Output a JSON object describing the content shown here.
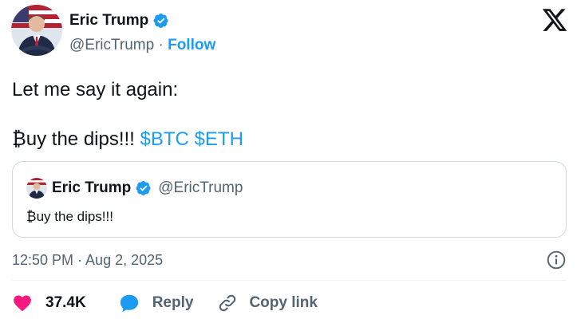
{
  "author": {
    "name": "Eric Trump",
    "handle": "@EricTrump",
    "separator": "·",
    "follow_label": "Follow",
    "verified": true
  },
  "tweet": {
    "lines": [
      "Let me say it again:",
      "₿uy the dips!!!"
    ],
    "cashtags": [
      "$BTC",
      "$ETH"
    ]
  },
  "quoted": {
    "name": "Eric Trump",
    "handle": "@EricTrump",
    "text": "₿uy the dips!!!"
  },
  "timestamp": "12:50 PM · Aug 2, 2025",
  "actions": {
    "like_count": "37.4K",
    "reply_label": "Reply",
    "copy_label": "Copy link"
  },
  "icons": {
    "brand": "x-logo",
    "verified": "verified-badge-icon",
    "info": "info-icon",
    "like": "heart-icon",
    "reply": "speech-bubble-icon",
    "copy": "link-icon"
  },
  "colors": {
    "link": "#1d9bf0",
    "text": "#0f1419",
    "muted": "#536471",
    "like": "#f91880",
    "border": "#cfd9de"
  }
}
